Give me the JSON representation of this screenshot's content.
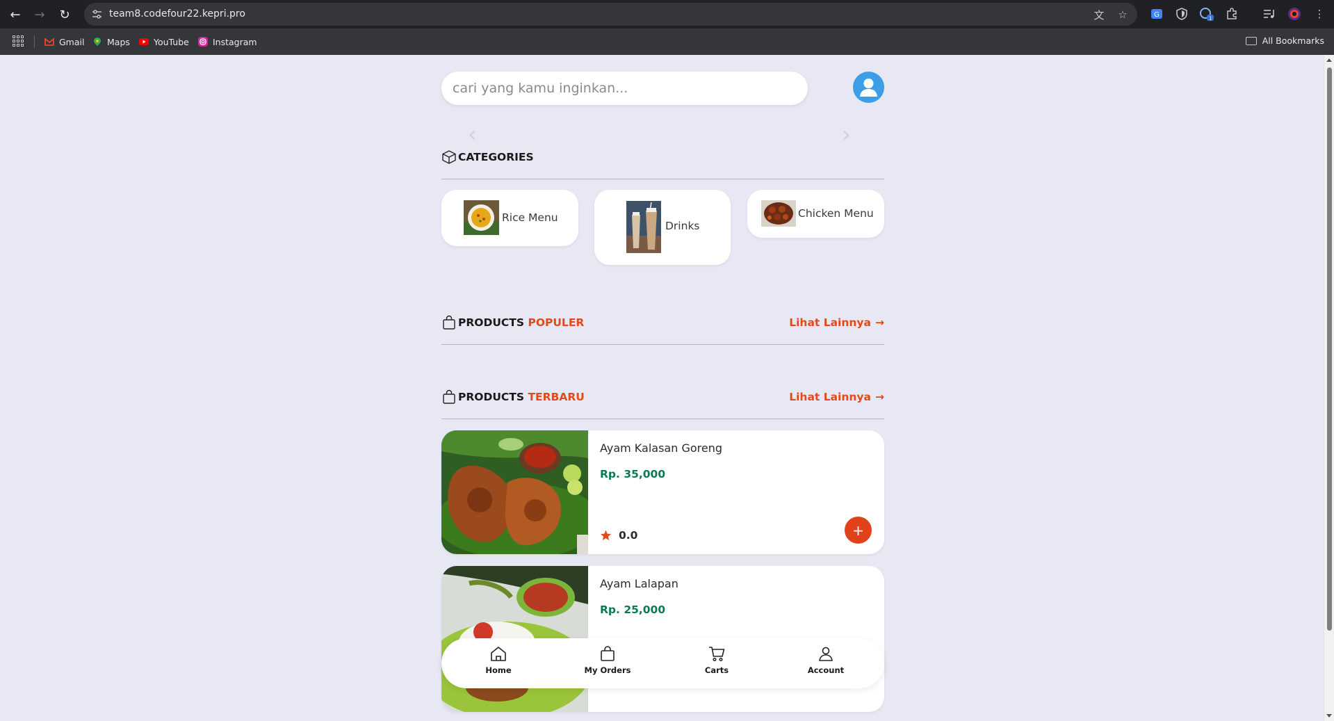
{
  "browser": {
    "url": "team8.codefour22.kepri.pro",
    "bookmarks": [
      {
        "label": "Gmail",
        "color": "#ea4335"
      },
      {
        "label": "Maps",
        "color": "#34a853"
      },
      {
        "label": "YouTube",
        "color": "#ff0000"
      },
      {
        "label": "Instagram",
        "color": "#d6249f"
      }
    ],
    "all_bookmarks": "All Bookmarks"
  },
  "search": {
    "placeholder": "cari yang kamu inginkan..."
  },
  "categories": {
    "title": "CATEGORIES",
    "items": [
      {
        "label": "Rice Menu"
      },
      {
        "label": "Drinks"
      },
      {
        "label": "Chicken Menu"
      }
    ]
  },
  "popular": {
    "title": "PRODUCTS",
    "accent": "POPULER",
    "more": "Lihat Lainnya",
    "more_arrow": "→"
  },
  "latest": {
    "title": "PRODUCTS",
    "accent": "TERBARU",
    "more": "Lihat Lainnya",
    "more_arrow": "→",
    "products": [
      {
        "name": "Ayam Kalasan Goreng",
        "price": "Rp. 35,000",
        "rating": "0.0",
        "add": "+"
      },
      {
        "name": "Ayam Lalapan",
        "price": "Rp. 25,000"
      }
    ]
  },
  "bottom_nav": [
    {
      "label": "Home",
      "icon": "home-icon"
    },
    {
      "label": "My Orders",
      "icon": "bag-icon"
    },
    {
      "label": "Carts",
      "icon": "cart-icon"
    },
    {
      "label": "Account",
      "icon": "user-icon"
    }
  ],
  "colors": {
    "accent": "#e24a1a",
    "price": "#0b7a52",
    "background": "#e8e8f5",
    "avatar": "#3d9ee8"
  }
}
